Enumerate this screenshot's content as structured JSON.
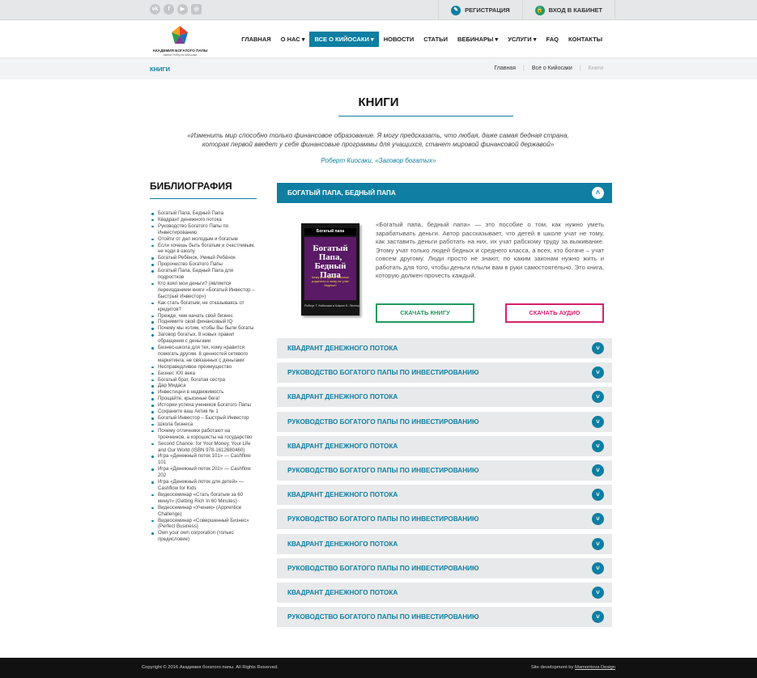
{
  "top": {
    "social": [
      "vk-icon",
      "facebook-icon",
      "youtube-icon",
      "instagram-icon"
    ],
    "social_glyphs": [
      "vk",
      "f",
      "▶",
      "◎"
    ],
    "register": "РЕГИСТРАЦИЯ",
    "login": "ВХОД В КАБИНЕТ",
    "register_icon": "✎",
    "login_icon": "🔒"
  },
  "logo": {
    "name": "АКАДЕМИЯ БОГАТОГО ПАПЫ",
    "tagline": "имени Роберта Кийосаки"
  },
  "nav": [
    {
      "label": "ГЛАВНАЯ",
      "active": false
    },
    {
      "label": "О НАС ▾",
      "active": false
    },
    {
      "label": "ВСЕ О КИЙОСАКИ ▾",
      "active": true
    },
    {
      "label": "НОВОСТИ",
      "active": false
    },
    {
      "label": "СТАТЬИ",
      "active": false
    },
    {
      "label": "ВЕБИНАРЫ ▾",
      "active": false
    },
    {
      "label": "УСЛУГИ ▾",
      "active": false
    },
    {
      "label": "FAQ",
      "active": false
    },
    {
      "label": "КОНТАКТЫ",
      "active": false
    }
  ],
  "breadcrumb": {
    "title": "КНИГИ",
    "items": [
      "Главная",
      "Все о Кийосаки",
      "Книги"
    ]
  },
  "page": {
    "title": "КНИГИ",
    "quote": "«Изменить мир способно только финансовое образование. Я могу предсказать, что любая, даже самая бедная страна, которая первой введет у себя финансовые программы для учащихся, станет мировой финансовой державой»",
    "quote_author": "Роберт Киосаки, «Заговор богатых»"
  },
  "bibliography": {
    "title": "БИБЛИОГРАФИЯ",
    "items": [
      "Богатый Папа, Бедный Папа",
      "Квадрант денежного потока",
      "Руководство Богатого Папы по Инвестированию",
      "Отойти от дел молодым и богатым",
      "Если хочешь быть богатым и счастливым, не ходи в школу",
      "Богатый Ребёнок, Умный Ребёнок",
      "Пророчество Богатого Папы",
      "Богатый Папа, Бедный Папа для подростков",
      "Кто взял мои деньги? (является переизданием книги «Богатый Инвестор – Быстрый Инвестор»)",
      "Как стать богатым, не отказываясь от кредитов?",
      "Прежде, чем начать свой бизнес",
      "Поднимите свой финансовый IQ",
      "Почему мы хотим, чтобы Вы были богаты",
      "Заговор богатых. 8 новых правил обращения с деньгами",
      "Бизнес-школа для тех, кому нравится помогать другим. 8 ценностей сетевого маркетинга, не связанных с деньгами",
      "Несправедливое преимущество",
      "Бизнес XXI века",
      "Богатый брат, богатая сестра",
      "Дар Мидаса",
      "Инвестиции в недвижимость",
      "Прощайте, крысиные бега!",
      "Истории успеха учеников Богатого Папы",
      "Сохраните ваш Актив № 1",
      "Богатый Инвестор – Быстрый Инвестор",
      "Школа бизнеса",
      "Почему отличники работают на троечников, а хорошисты на государство",
      "Second Chance: for Your Money, Your Life and Our World (ISBN 978-1612680460)",
      "Игра «Денежный поток 101» — Cashflow 101",
      "Игра «Денежный поток 202» — Cashflow 202",
      "Игра «Денежный поток для детей» — Cashflow for Kids",
      "Видеосеминар «Стать богатым за 60 минут» (Getting Rich In 60 Minutes)",
      "Видеосеминар «Ученик» (Apprentice Challenge)",
      "Видеосеминар «Совершенный Бизнес» (Perfect Business)",
      "Own your own corporation (только предисловие)"
    ]
  },
  "open_book": {
    "title": "БОГАТЫЙ ПАПА, БЕДНЫЙ ПАПА",
    "cover_brand": "Богатый папа",
    "cover_title": "Богатый Папа, Бедный Папа",
    "cover_sub": "Чему учат детей богатые родители и чему не учат бедные!",
    "cover_author": "Роберт Т. Кийосаки и Шэрон Л. Лектер",
    "description": "«Богатый папа, бедный папа» — это пособие о том, как нужно уметь зарабатывать деньги. Автор рассказывает, что детей в школе учат не тому, как заставить деньги работать на них, их учат рабскому труду за выживание. Этому учат только людей бедных и среднего класса, а всех, кто богаче – учат совсем другому. Люди просто не знают, по каким законам нужно жить и работать для того, чтобы деньги плыли вам в руки самостоятельно. Это книга, которую должен прочесть каждый.",
    "download_book": "СКАЧАТЬ КНИГУ",
    "download_audio": "СКАЧАТЬ АУДИО"
  },
  "accordion": [
    "КВАДРАНТ ДЕНЕЖНОГО ПОТОКА",
    "РУКОВОДСТВО БОГАТОГО ПАПЫ ПО ИНВЕСТИРОВАНИЮ",
    "КВАДРАНТ ДЕНЕЖНОГО ПОТОКА",
    "РУКОВОДСТВО БОГАТОГО ПАПЫ ПО ИНВЕСТИРОВАНИЮ",
    "КВАДРАНТ ДЕНЕЖНОГО ПОТОКА",
    "РУКОВОДСТВО БОГАТОГО ПАПЫ ПО ИНВЕСТИРОВАНИЮ",
    "КВАДРАНТ ДЕНЕЖНОГО ПОТОКА",
    "РУКОВОДСТВО БОГАТОГО ПАПЫ ПО ИНВЕСТИРОВАНИЮ",
    "КВАДРАНТ ДЕНЕЖНОГО ПОТОКА",
    "РУКОВОДСТВО БОГАТОГО ПАПЫ ПО ИНВЕСТИРОВАНИЮ",
    "КВАДРАНТ ДЕНЕЖНОГО ПОТОКА",
    "РУКОВОДСТВО БОГАТОГО ПАПЫ ПО ИНВЕСТИРОВАНИЮ"
  ],
  "footer": {
    "copyright": "Copyright © 2016 Академия богатого папы. All Rights Reserved.",
    "dev_prefix": "Site development by",
    "dev_name": "Mamontova Design"
  },
  "colors": {
    "accent": "#0e7fa2",
    "green": "#1f9b5f",
    "pink": "#d6206e",
    "register_icon_bg": "#0e7fa2",
    "login_icon_bg": "#1f9b5f"
  }
}
